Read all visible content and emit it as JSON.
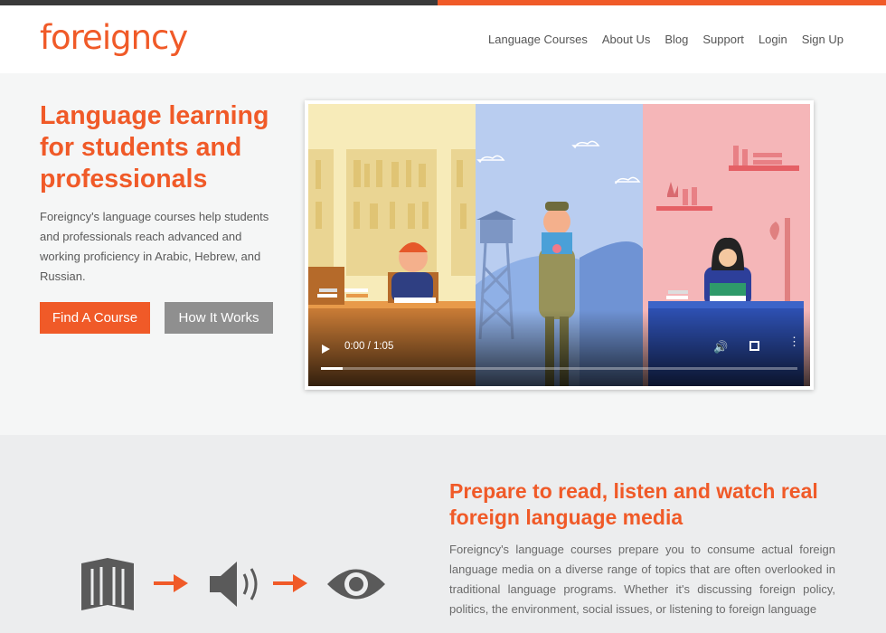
{
  "header": {
    "logo": "foreigncy",
    "nav": [
      "Language Courses",
      "About Us",
      "Blog",
      "Support",
      "Login",
      "Sign Up"
    ]
  },
  "hero": {
    "title": "Language learning for students and professionals",
    "description": "Foreigncy's language courses help students and professionals reach advanced and working proficiency in Arabic, Hebrew, and Russian.",
    "find_course_label": "Find A Course",
    "how_it_works_label": "How It Works"
  },
  "video": {
    "time": "0:00 / 1:05",
    "progress": 0.0
  },
  "section2": {
    "title": "Prepare to read, listen and watch real foreign language media",
    "description": "Foreigncy's language courses prepare you to consume actual foreign language media on a diverse range of topics that are often overlooked in traditional language programs. Whether it's discussing foreign policy, politics, the environment, social issues, or listening to foreign language",
    "icons": [
      "book-icon",
      "arrow-right-icon",
      "speaker-icon",
      "arrow-right-icon",
      "eye-icon"
    ]
  },
  "colors": {
    "accent": "#f05a28",
    "gray_button": "#8f8f8f",
    "dark_bar": "#3a3a3a"
  }
}
